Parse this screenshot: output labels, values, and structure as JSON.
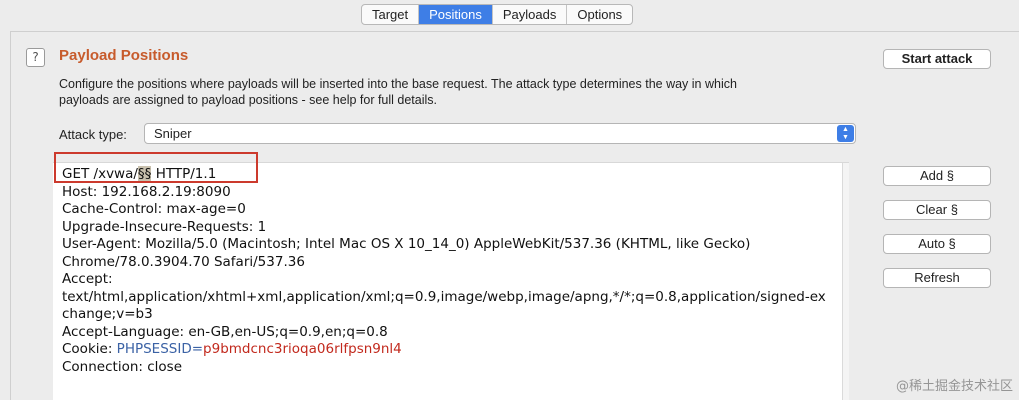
{
  "tabs": [
    {
      "label": "Target",
      "active": false
    },
    {
      "label": "Positions",
      "active": true
    },
    {
      "label": "Payloads",
      "active": false
    },
    {
      "label": "Options",
      "active": false
    }
  ],
  "panel": {
    "help_icon": "?",
    "title": "Payload Positions",
    "description_line1": "Configure the positions where payloads will be inserted into the base request. The attack type determines the way in which",
    "description_line2": "payloads are assigned to payload positions - see help for full details.",
    "attack_type_label": "Attack type:",
    "attack_type_value": "Sniper",
    "start_attack": "Start attack"
  },
  "request": {
    "line1_prefix": "GET /xvwa/",
    "line1_marker": "§§",
    "line1_suffix": " HTTP/1.1",
    "host": "Host: 192.168.2.19:8090",
    "cache_control": "Cache-Control: max-age=0",
    "upgrade": "Upgrade-Insecure-Requests: 1",
    "user_agent_1": "User-Agent: Mozilla/5.0 (Macintosh; Intel Mac OS X 10_14_0) AppleWebKit/537.36 (KHTML, like Gecko)",
    "user_agent_2": "Chrome/78.0.3904.70 Safari/537.36",
    "accept": "Accept:",
    "accept_value_1": "text/html,application/xhtml+xml,application/xml;q=0.9,image/webp,image/apng,*/*;q=0.8,application/signed-ex",
    "accept_value_2": "change;v=b3",
    "accept_language": "Accept-Language: en-GB,en-US;q=0.9,en;q=0.8",
    "cookie_label": "Cookie: ",
    "cookie_name": "PHPSESSID",
    "cookie_eq": "=",
    "cookie_value": "p9bmdcnc3rioqa06rlfpsn9nl4",
    "connection": "Connection: close"
  },
  "buttons": {
    "add": "Add §",
    "clear": "Clear §",
    "auto": "Auto §",
    "refresh": "Refresh"
  },
  "watermark": "@稀土掘金技术社区",
  "colors": {
    "accent": "#3e7ee6",
    "title": "#c75b2c",
    "highlight_box": "#cc3a2d",
    "cookie_name": "#3b62a5",
    "cookie_value": "#c2291d"
  }
}
